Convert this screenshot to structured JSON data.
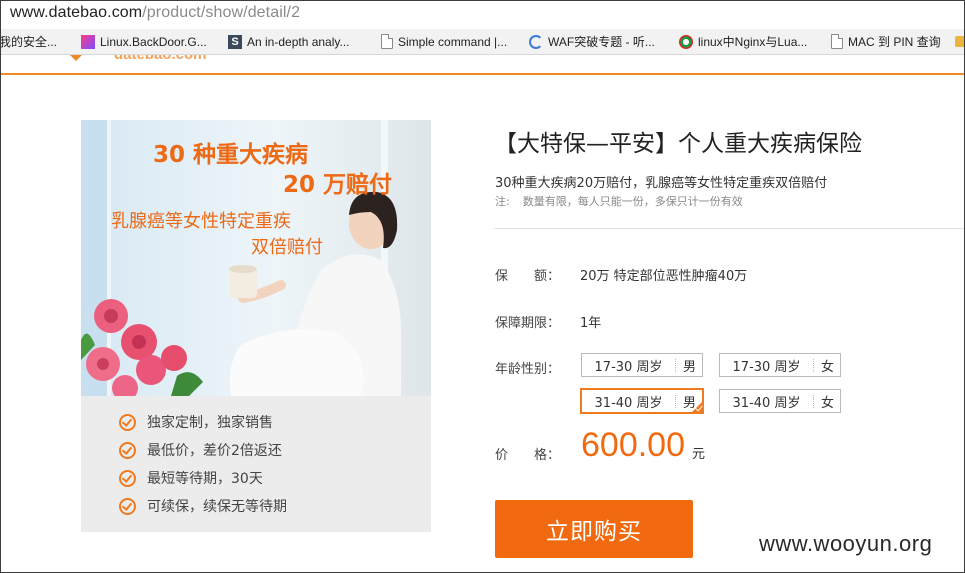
{
  "browser": {
    "url_host": "www.datebao.com",
    "url_path": "/product/show/detail/2",
    "bookmarks": [
      {
        "label": "我的安全...",
        "icon": "none"
      },
      {
        "label": "Linux.BackDoor.G...",
        "icon": "multicolor-square-icon"
      },
      {
        "label": "An in-depth analy...",
        "icon": "s-logo-icon"
      },
      {
        "label": "Simple command |...",
        "icon": "page-icon"
      },
      {
        "label": "WAF突破专题 - 听...",
        "icon": "refresh-icon"
      },
      {
        "label": "linux中Nginx与Lua...",
        "icon": "ring-logo-icon"
      },
      {
        "label": "MAC 到 PIN 查询",
        "icon": "page-icon"
      }
    ]
  },
  "site": {
    "logo_text": "datebao.com",
    "accent": "#f26a10"
  },
  "product": {
    "image_text": {
      "line1": "30 种重大疾病",
      "line2": "20 万赔付",
      "line3": "乳腺癌等女性特定重疾",
      "line4": "双倍赔付"
    },
    "features": [
      "独家定制，独家销售",
      "最低价，差价2倍返还",
      "最短等待期，30天",
      "可续保，续保无等待期"
    ],
    "title": "【大特保—平安】个人重大疾病保险",
    "subtitle": "30种重大疾病20万赔付，乳腺癌等女性特定重疾双倍赔付",
    "note_label": "注:",
    "note_text": "数量有限，每人只能一份，多保只计一份有效",
    "coverage_label": "保　　额：",
    "coverage_value": "20万  特定部位恶性肿瘤40万",
    "period_label": "保障期限：",
    "period_value": "1年",
    "age_label": "年龄性别：",
    "options": [
      {
        "age": "17-30 周岁",
        "gender": "男",
        "selected": false
      },
      {
        "age": "17-30 周岁",
        "gender": "女",
        "selected": false
      },
      {
        "age": "31-40 周岁",
        "gender": "男",
        "selected": true
      },
      {
        "age": "31-40 周岁",
        "gender": "女",
        "selected": false
      }
    ],
    "price_label": "价　　格：",
    "price": "600.00",
    "price_unit": "元",
    "buy_label": "立即购买"
  },
  "watermark": "www.wooyun.org"
}
